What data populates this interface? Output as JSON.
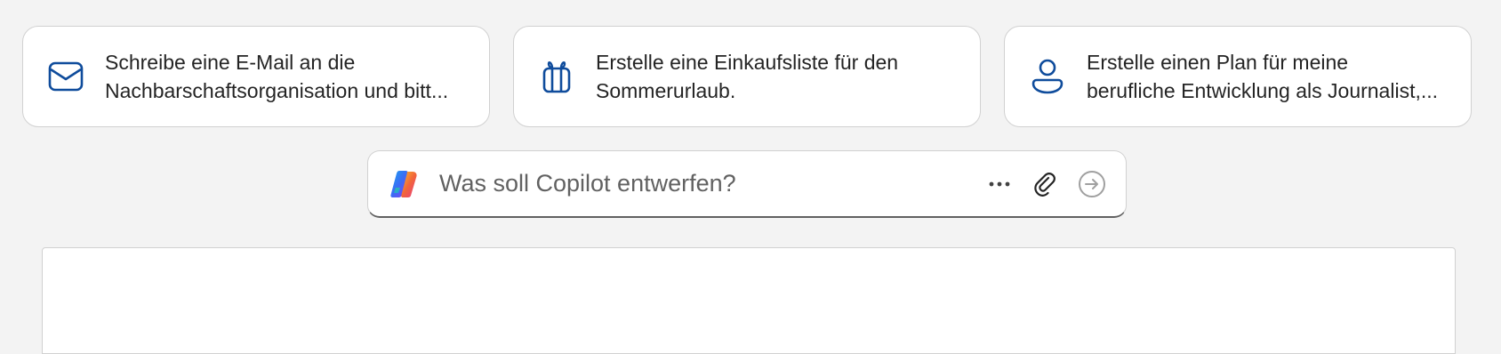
{
  "suggestions": [
    {
      "icon": "mail-icon",
      "line1": "Schreibe eine E-Mail an die",
      "line2": "Nachbarschaftsorganisation und bitt..."
    },
    {
      "icon": "gift-icon",
      "line1": "Erstelle eine Einkaufsliste für den",
      "line2": "Sommerurlaub."
    },
    {
      "icon": "person-icon",
      "line1": "Erstelle einen Plan für meine",
      "line2": "berufliche Entwicklung als Journalist,..."
    }
  ],
  "prompt": {
    "placeholder": "Was soll Copilot entwerfen?",
    "more_icon": "more-horizontal-icon",
    "attach_icon": "paperclip-icon",
    "send_icon": "send-arrow-icon"
  },
  "colors": {
    "background": "#f3f3f3",
    "card_border": "#d1d1d1",
    "icon_accent": "#0f4c9c",
    "text": "#242424"
  }
}
